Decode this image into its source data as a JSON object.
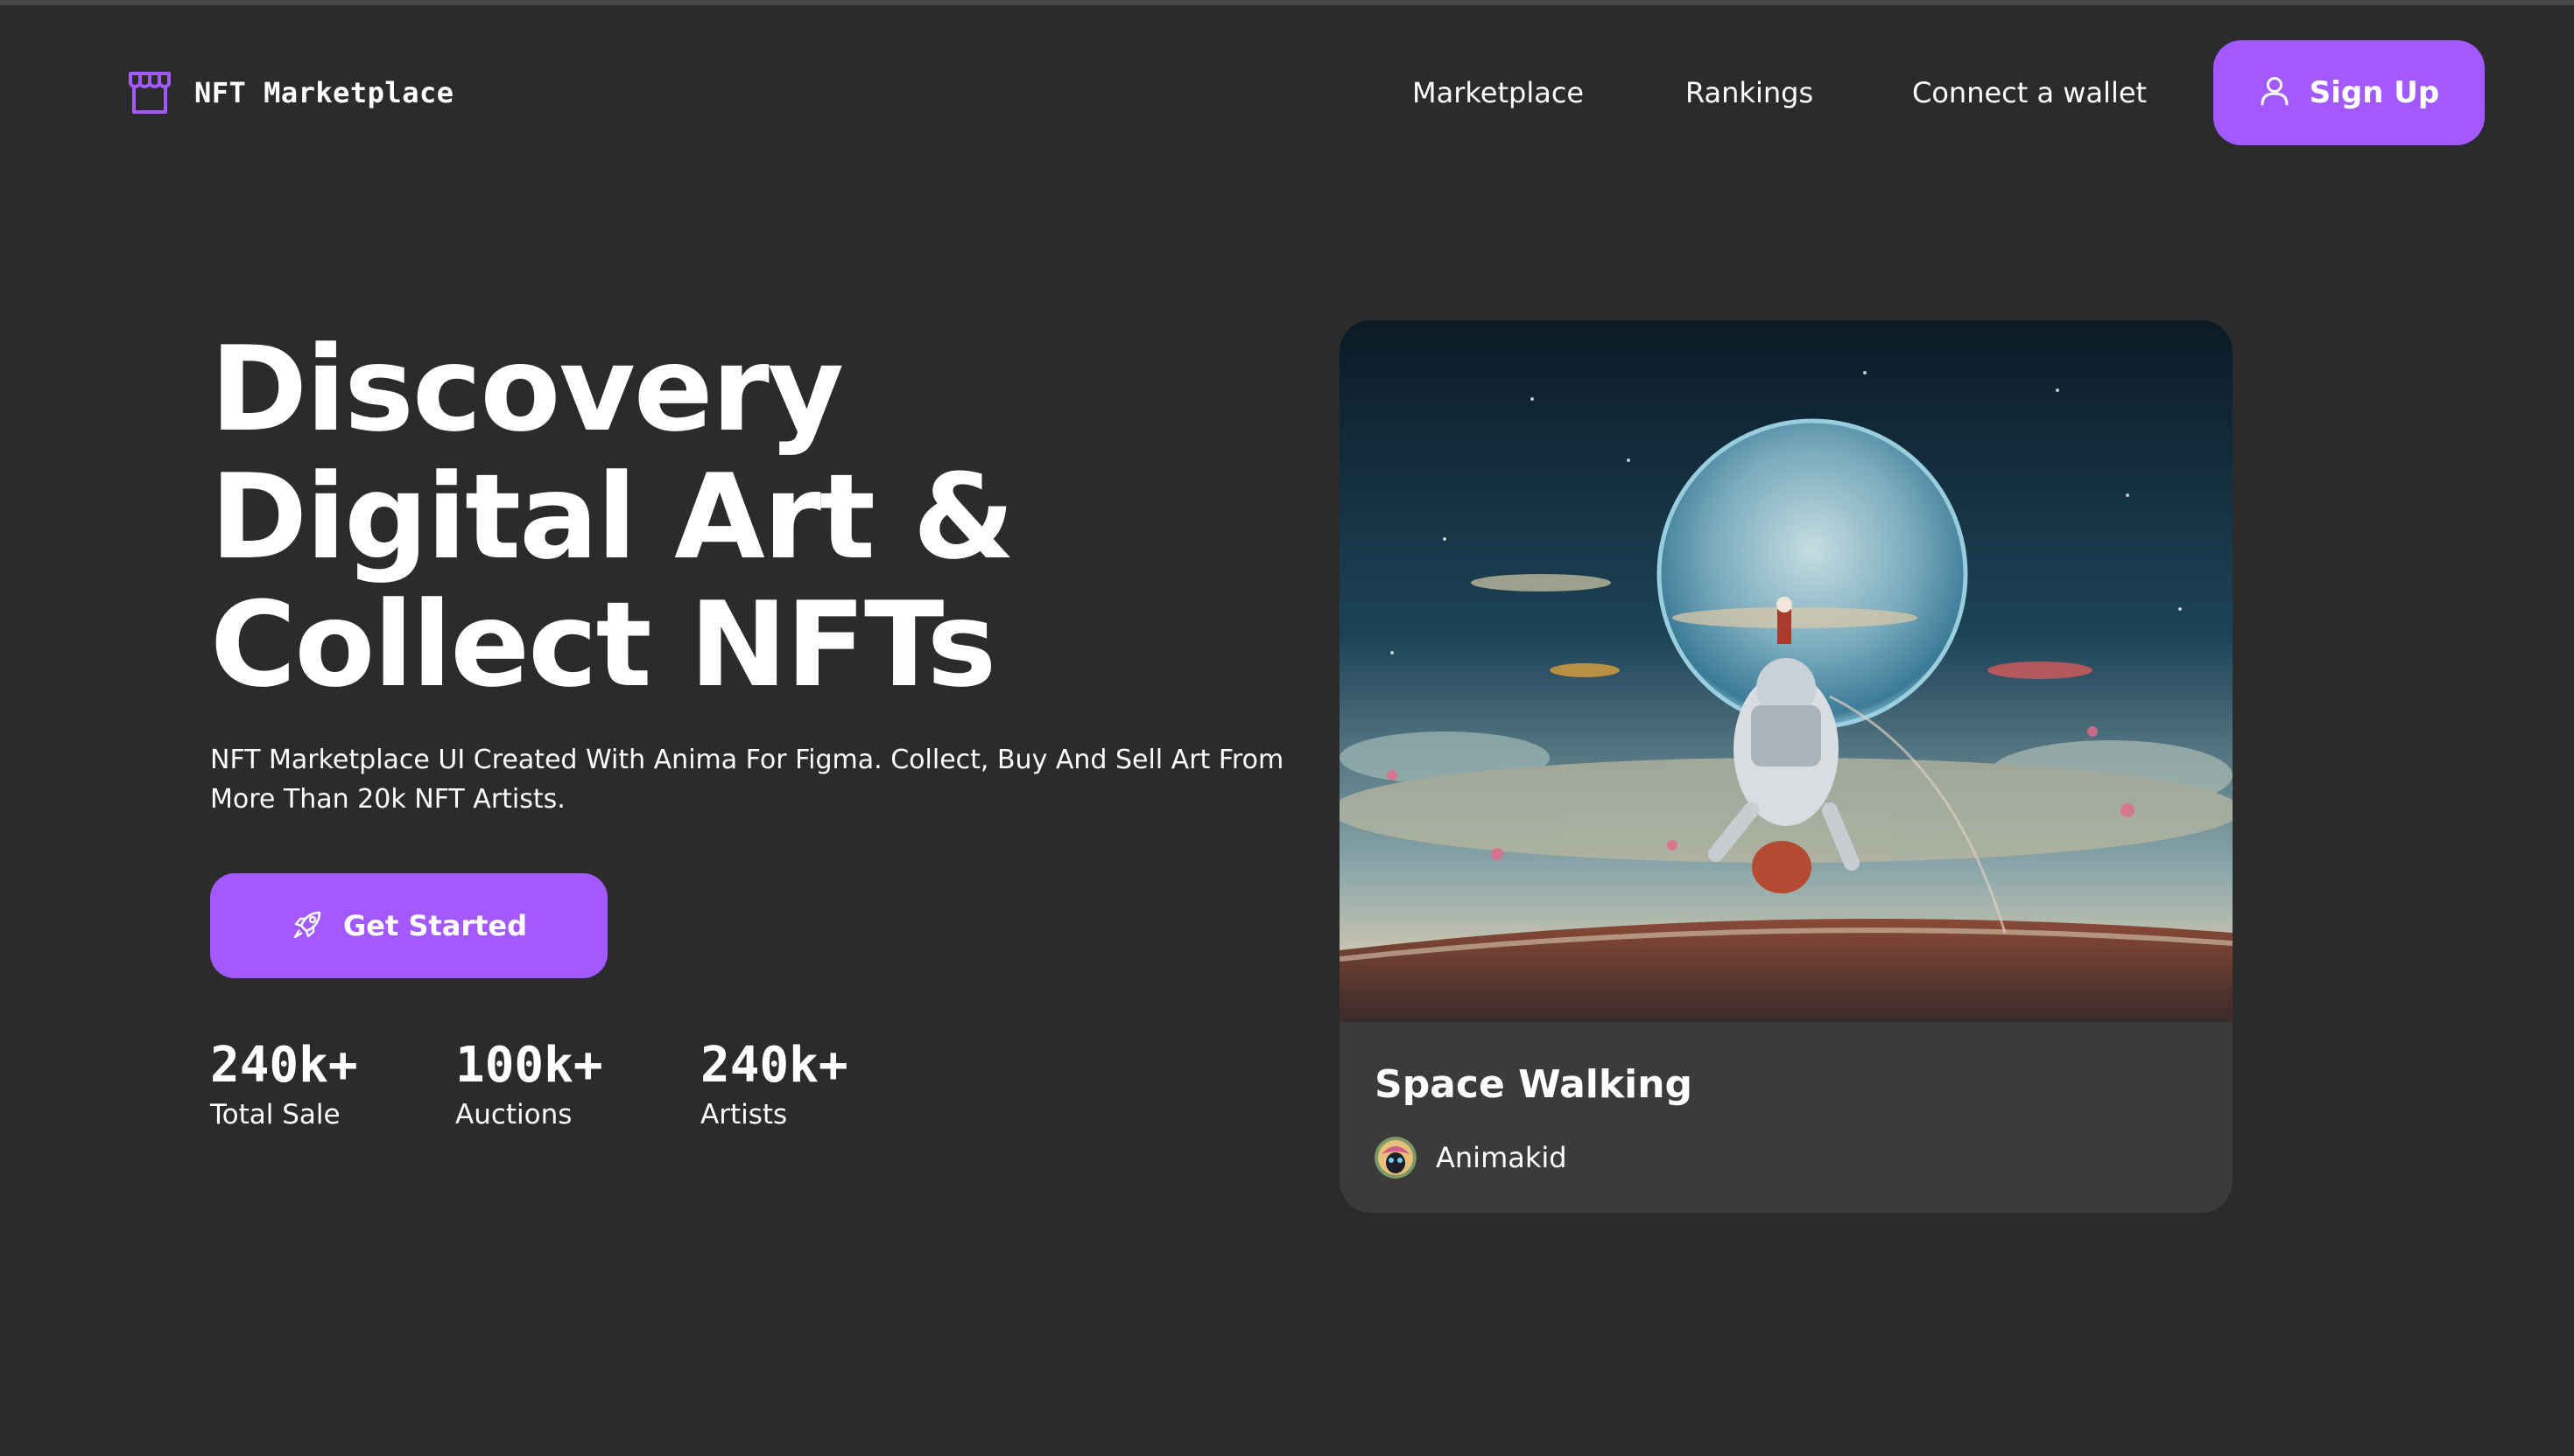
{
  "brand": {
    "name": "NFT Marketplace",
    "icon": "storefront-icon",
    "accent_color": "#a259ff"
  },
  "nav": {
    "links": [
      "Marketplace",
      "Rankings",
      "Connect a wallet"
    ],
    "signup": {
      "label": "Sign Up",
      "icon": "user-icon"
    }
  },
  "hero": {
    "title": "Discovery\nDigital Art &\nCollect NFTs",
    "subtitle": "NFT Marketplace UI Created With Anima For Figma. Collect, Buy And Sell Art From More Than 20k NFT Artists.",
    "cta": {
      "label": "Get Started",
      "icon": "rocket-icon"
    },
    "stats": [
      {
        "value": "240k+",
        "label": "Total Sale"
      },
      {
        "value": "100k+",
        "label": "Auctions"
      },
      {
        "value": "240k+",
        "label": "Artists"
      }
    ]
  },
  "featured": {
    "title": "Space Walking",
    "artist": "Animakid"
  },
  "colors": {
    "background": "#2b2b2b",
    "card": "#3b3b3b",
    "accent": "#a259ff",
    "text": "#ffffff"
  }
}
